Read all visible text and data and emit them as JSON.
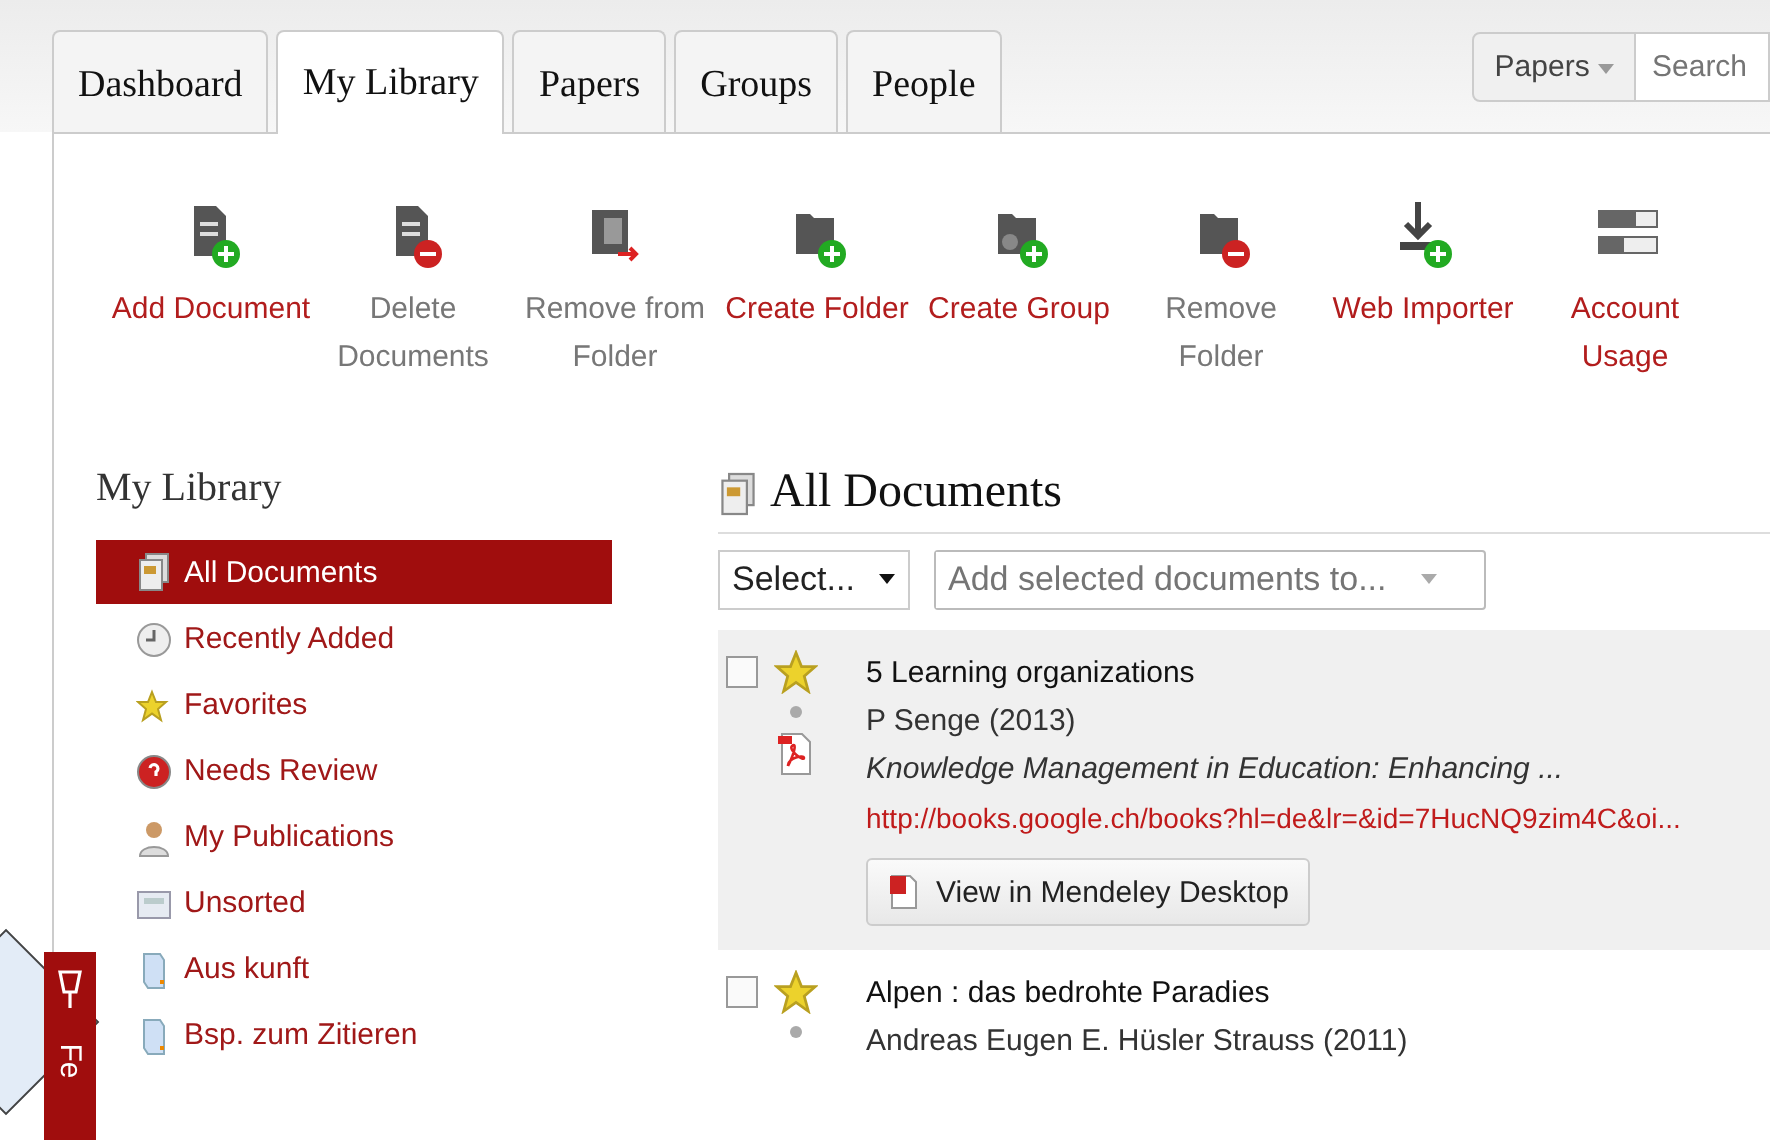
{
  "tabs": [
    {
      "label": "Dashboard",
      "selected": false
    },
    {
      "label": "My Library",
      "selected": true
    },
    {
      "label": "Papers",
      "selected": false
    },
    {
      "label": "Groups",
      "selected": false
    },
    {
      "label": "People",
      "selected": false
    }
  ],
  "search": {
    "scope": "Papers",
    "placeholder": "Search"
  },
  "toolbar": [
    {
      "kind": "add-document",
      "label": "Add Document",
      "disabled": false
    },
    {
      "kind": "delete-document",
      "label": "Delete Documents",
      "disabled": true
    },
    {
      "kind": "remove-from-folder",
      "label": "Remove from Folder",
      "disabled": true
    },
    {
      "kind": "create-folder",
      "label": "Create Folder",
      "disabled": false
    },
    {
      "kind": "create-group",
      "label": "Create Group",
      "disabled": false
    },
    {
      "kind": "remove-folder",
      "label": "Remove Folder",
      "disabled": true
    },
    {
      "kind": "web-importer",
      "label": "Web Importer",
      "disabled": false
    },
    {
      "kind": "account-usage",
      "label": "Account Usage",
      "disabled": false
    }
  ],
  "sidebar": {
    "title": "My Library",
    "items": [
      {
        "kind": "documents",
        "label": "All Documents",
        "selected": true
      },
      {
        "kind": "clock",
        "label": "Recently Added",
        "selected": false
      },
      {
        "kind": "star",
        "label": "Favorites",
        "selected": false
      },
      {
        "kind": "review",
        "label": "Needs Review",
        "selected": false
      },
      {
        "kind": "person",
        "label": "My Publications",
        "selected": false
      },
      {
        "kind": "tray",
        "label": "Unsorted",
        "selected": false
      },
      {
        "kind": "folder",
        "label": "Aus kunft",
        "selected": false
      },
      {
        "kind": "folder",
        "label": "Bsp. zum Zitieren",
        "selected": false
      }
    ]
  },
  "feedback_tab": {
    "label": "Fe"
  },
  "content": {
    "title": "All Documents",
    "select": "Select...",
    "add_to": {
      "placeholder": "Add selected documents to..."
    },
    "documents": [
      {
        "checked": false,
        "starred": true,
        "has_pdf": true,
        "title": "5 Learning organizations",
        "authors": "P Senge (2013)",
        "source": "Knowledge Management in Education: Enhancing ...",
        "url": "http://books.google.ch/books?hl=de&lr=&id=7HucNQ9zim4C&oi...",
        "button": "View in Mendeley Desktop",
        "highlighted": true
      },
      {
        "checked": false,
        "starred": true,
        "has_pdf": false,
        "title": "Alpen : das bedrohte Paradies",
        "authors": "Andreas Eugen E. Hüsler Strauss (2011)",
        "highlighted": false
      }
    ]
  }
}
